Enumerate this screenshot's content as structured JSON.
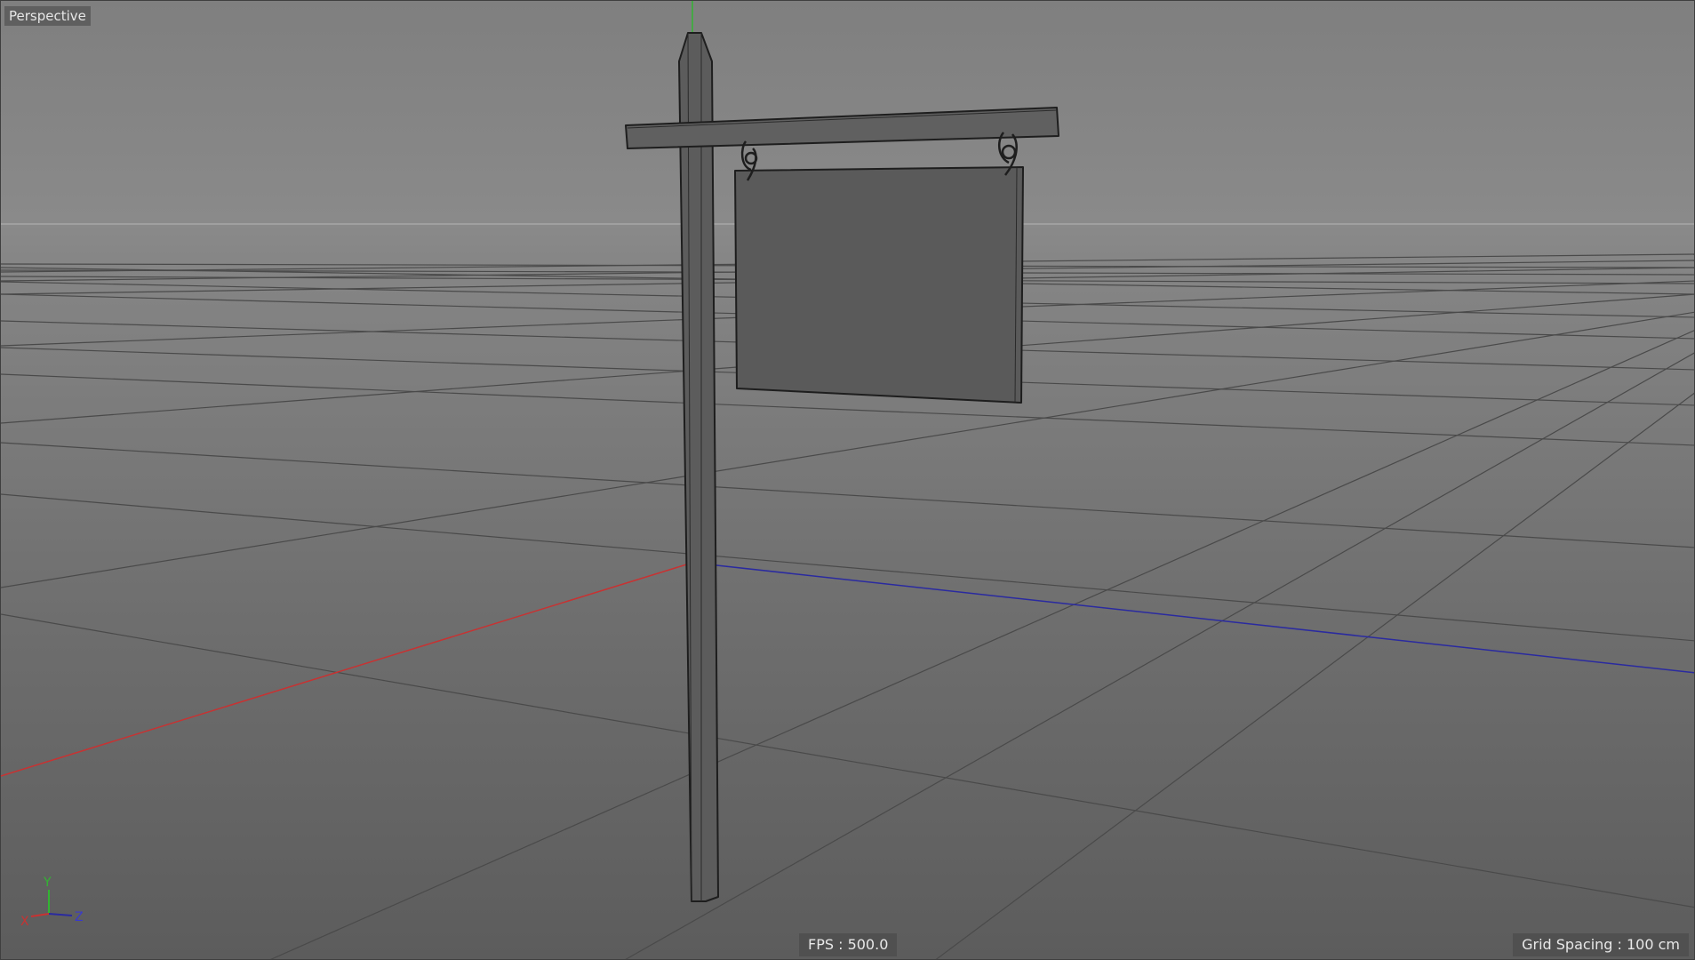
{
  "viewport": {
    "view_name": "Perspective",
    "fps_label": "FPS : 500.0",
    "grid_spacing_label": "Grid Spacing : 100 cm"
  },
  "axis_gizmo": {
    "y_label": "Y",
    "x_label": "X",
    "z_label": "Z"
  },
  "colors": {
    "x_axis": "#c83232",
    "y_axis": "#32b432",
    "z_axis": "#2a2aa0",
    "grid": "#4a4a4a",
    "horizon": "#a8a8a8",
    "object_fill": "#5a5a5a",
    "object_edge": "#1e1e1e"
  }
}
